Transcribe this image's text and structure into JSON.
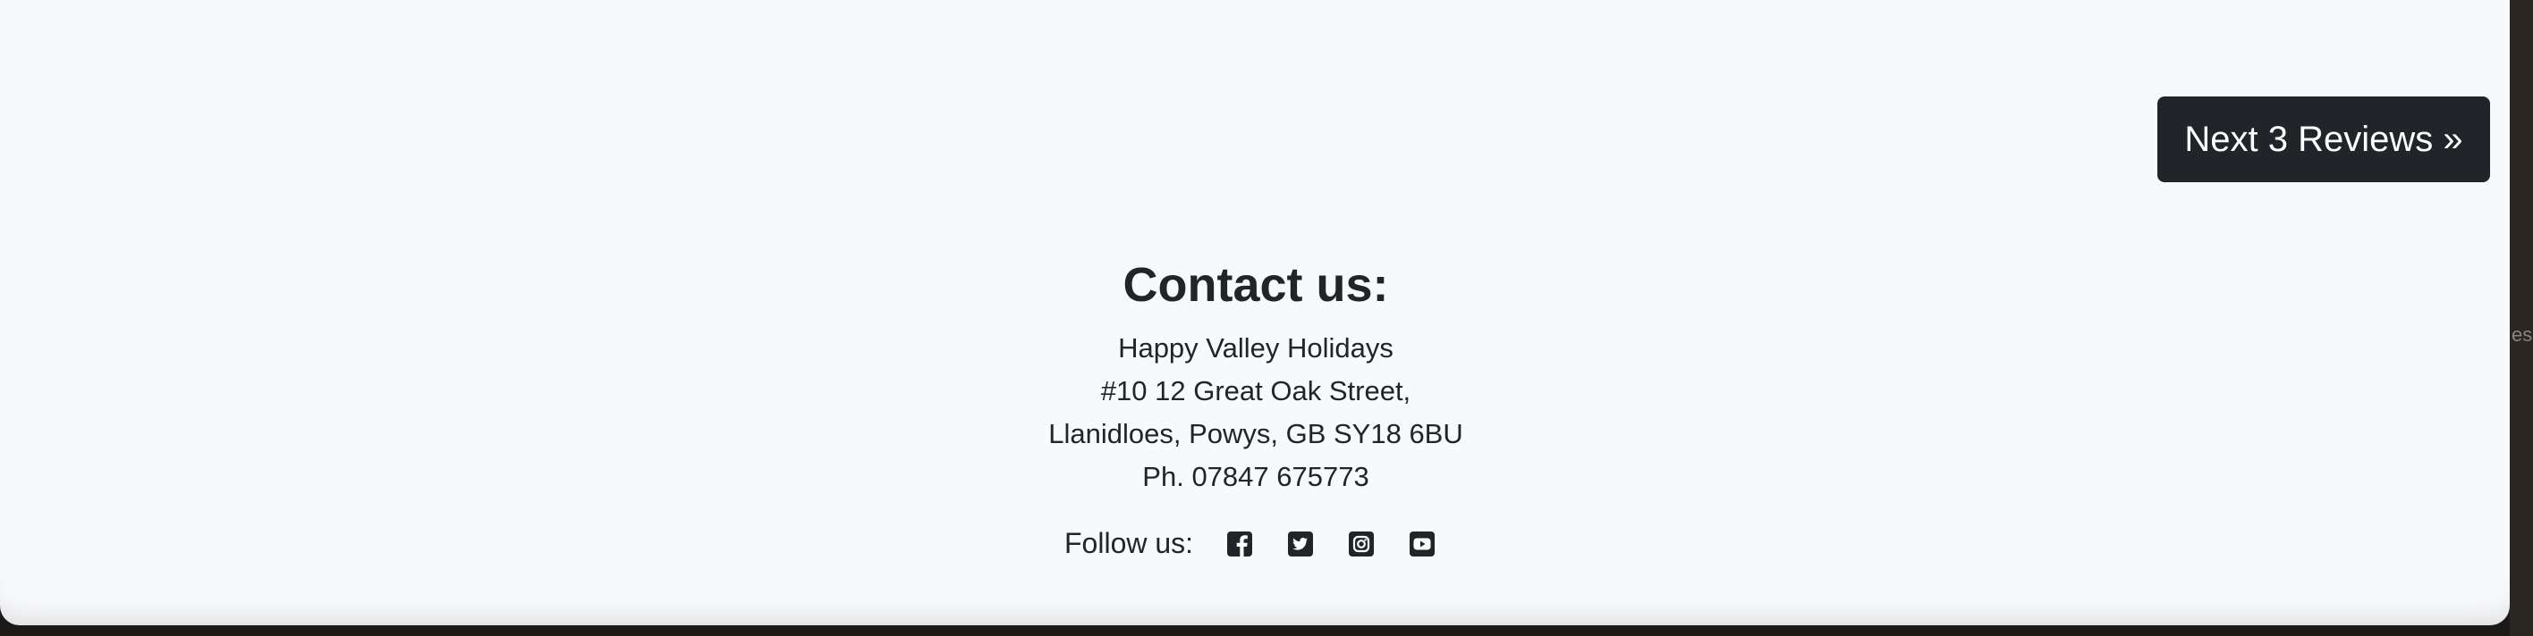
{
  "pagination": {
    "next_label": "Next 3 Reviews »"
  },
  "contact": {
    "title": "Contact us:",
    "address_lines": [
      "Happy Valley Holidays",
      "#10 12 Great Oak Street,",
      "Llanidloes, Powys, GB SY18 6BU",
      "Ph. 07847 675773"
    ]
  },
  "social": {
    "label": "Follow us:",
    "icons": [
      "facebook-icon",
      "twitter-icon",
      "instagram-icon",
      "youtube-icon"
    ]
  },
  "background_window": {
    "partial_text": "es"
  },
  "colors": {
    "page_background": "#f8f9fb",
    "button_background": "#212529",
    "button_text": "#ffffff",
    "text": "#212529"
  }
}
